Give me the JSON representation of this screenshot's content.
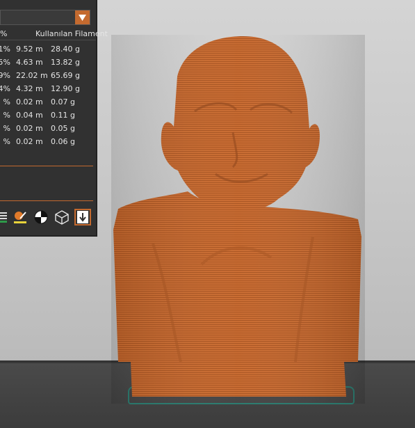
{
  "panel": {
    "column_header": "Kullanılan Filament",
    "column_header_pct": "%",
    "rows": [
      {
        "pct": "1%",
        "length": "9.52 m",
        "weight": "28.40 g"
      },
      {
        "pct": "5%",
        "length": "4.63 m",
        "weight": "13.82 g"
      },
      {
        "pct": "9%",
        "length": "22.02 m",
        "weight": "65.69 g"
      },
      {
        "pct": "4%",
        "length": "4.32 m",
        "weight": "12.90 g"
      },
      {
        "pct": "%",
        "length": "0.02 m",
        "weight": "0.07 g"
      },
      {
        "pct": "%",
        "length": "0.04 m",
        "weight": "0.11 g"
      },
      {
        "pct": "%",
        "length": "0.02 m",
        "weight": "0.05 g"
      },
      {
        "pct": "%",
        "length": "0.02 m",
        "weight": "0.06 g"
      }
    ]
  },
  "toolbar": {
    "icons": [
      "slice-preview-icon",
      "paint-brush-icon",
      "seam-painting-icon",
      "wireframe-cube-icon",
      "export-download-icon"
    ],
    "active_icon": "export-download-icon"
  },
  "colors": {
    "accent": "#c46a2f",
    "model": "#c8692e",
    "panel_bg": "#313131",
    "bed_outline": "#2a7a6e"
  }
}
